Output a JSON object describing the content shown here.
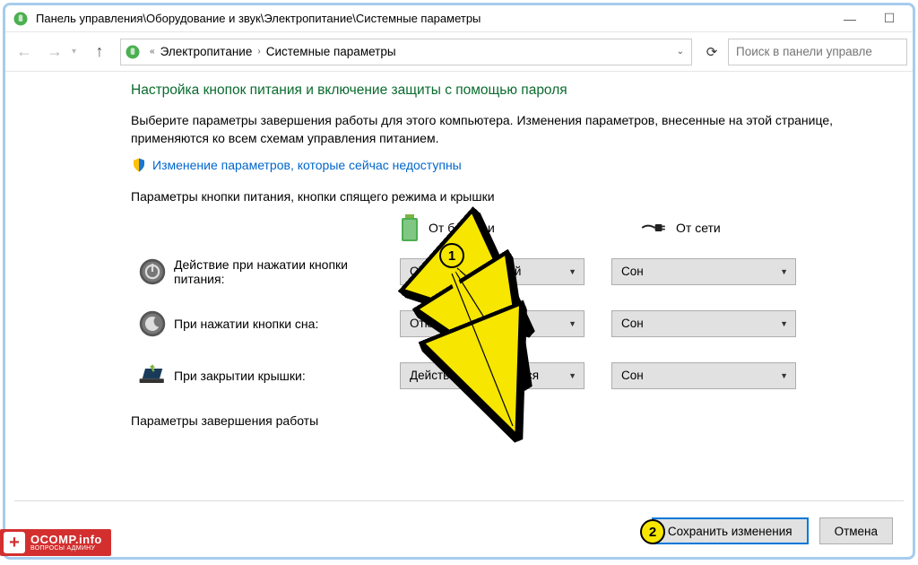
{
  "window": {
    "title": "Панель управления\\Оборудование и звук\\Электропитание\\Системные параметры",
    "minimize": "—",
    "maximize": "☐"
  },
  "breadcrumb": {
    "sep_left": "«",
    "items": [
      "Электропитание",
      "Системные параметры"
    ]
  },
  "search": {
    "placeholder": "Поиск в панели управле"
  },
  "page": {
    "heading": "Настройка кнопок питания и включение защиты с помощью пароля",
    "description": "Выберите параметры завершения работы для этого компьютера. Изменения параметров, внесенные на этой странице, применяются ко всем схемам управления питанием.",
    "uac_link": "Изменение параметров, которые сейчас недоступны",
    "section1": "Параметры кнопки питания, кнопки спящего режима и крышки",
    "col_battery": "От батареи",
    "col_ac": "От сети",
    "rows": [
      {
        "label": "Действие при нажатии кнопки питания:",
        "battery": "Отключить дисплей",
        "ac": "Сон"
      },
      {
        "label": "При нажатии кнопки сна:",
        "battery": "Отключить дисплей",
        "ac": "Сон"
      },
      {
        "label": "При закрытии крышки:",
        "battery": "Действие не требуется",
        "ac": "Сон"
      }
    ],
    "section2": "Параметры завершения работы"
  },
  "buttons": {
    "save": "Сохранить изменения",
    "cancel": "Отмена"
  },
  "annotations": {
    "badge1": "1",
    "badge2": "2"
  },
  "watermark": {
    "main": "OCOMP.info",
    "sub": "ВОПРОСЫ АДМИНУ"
  }
}
